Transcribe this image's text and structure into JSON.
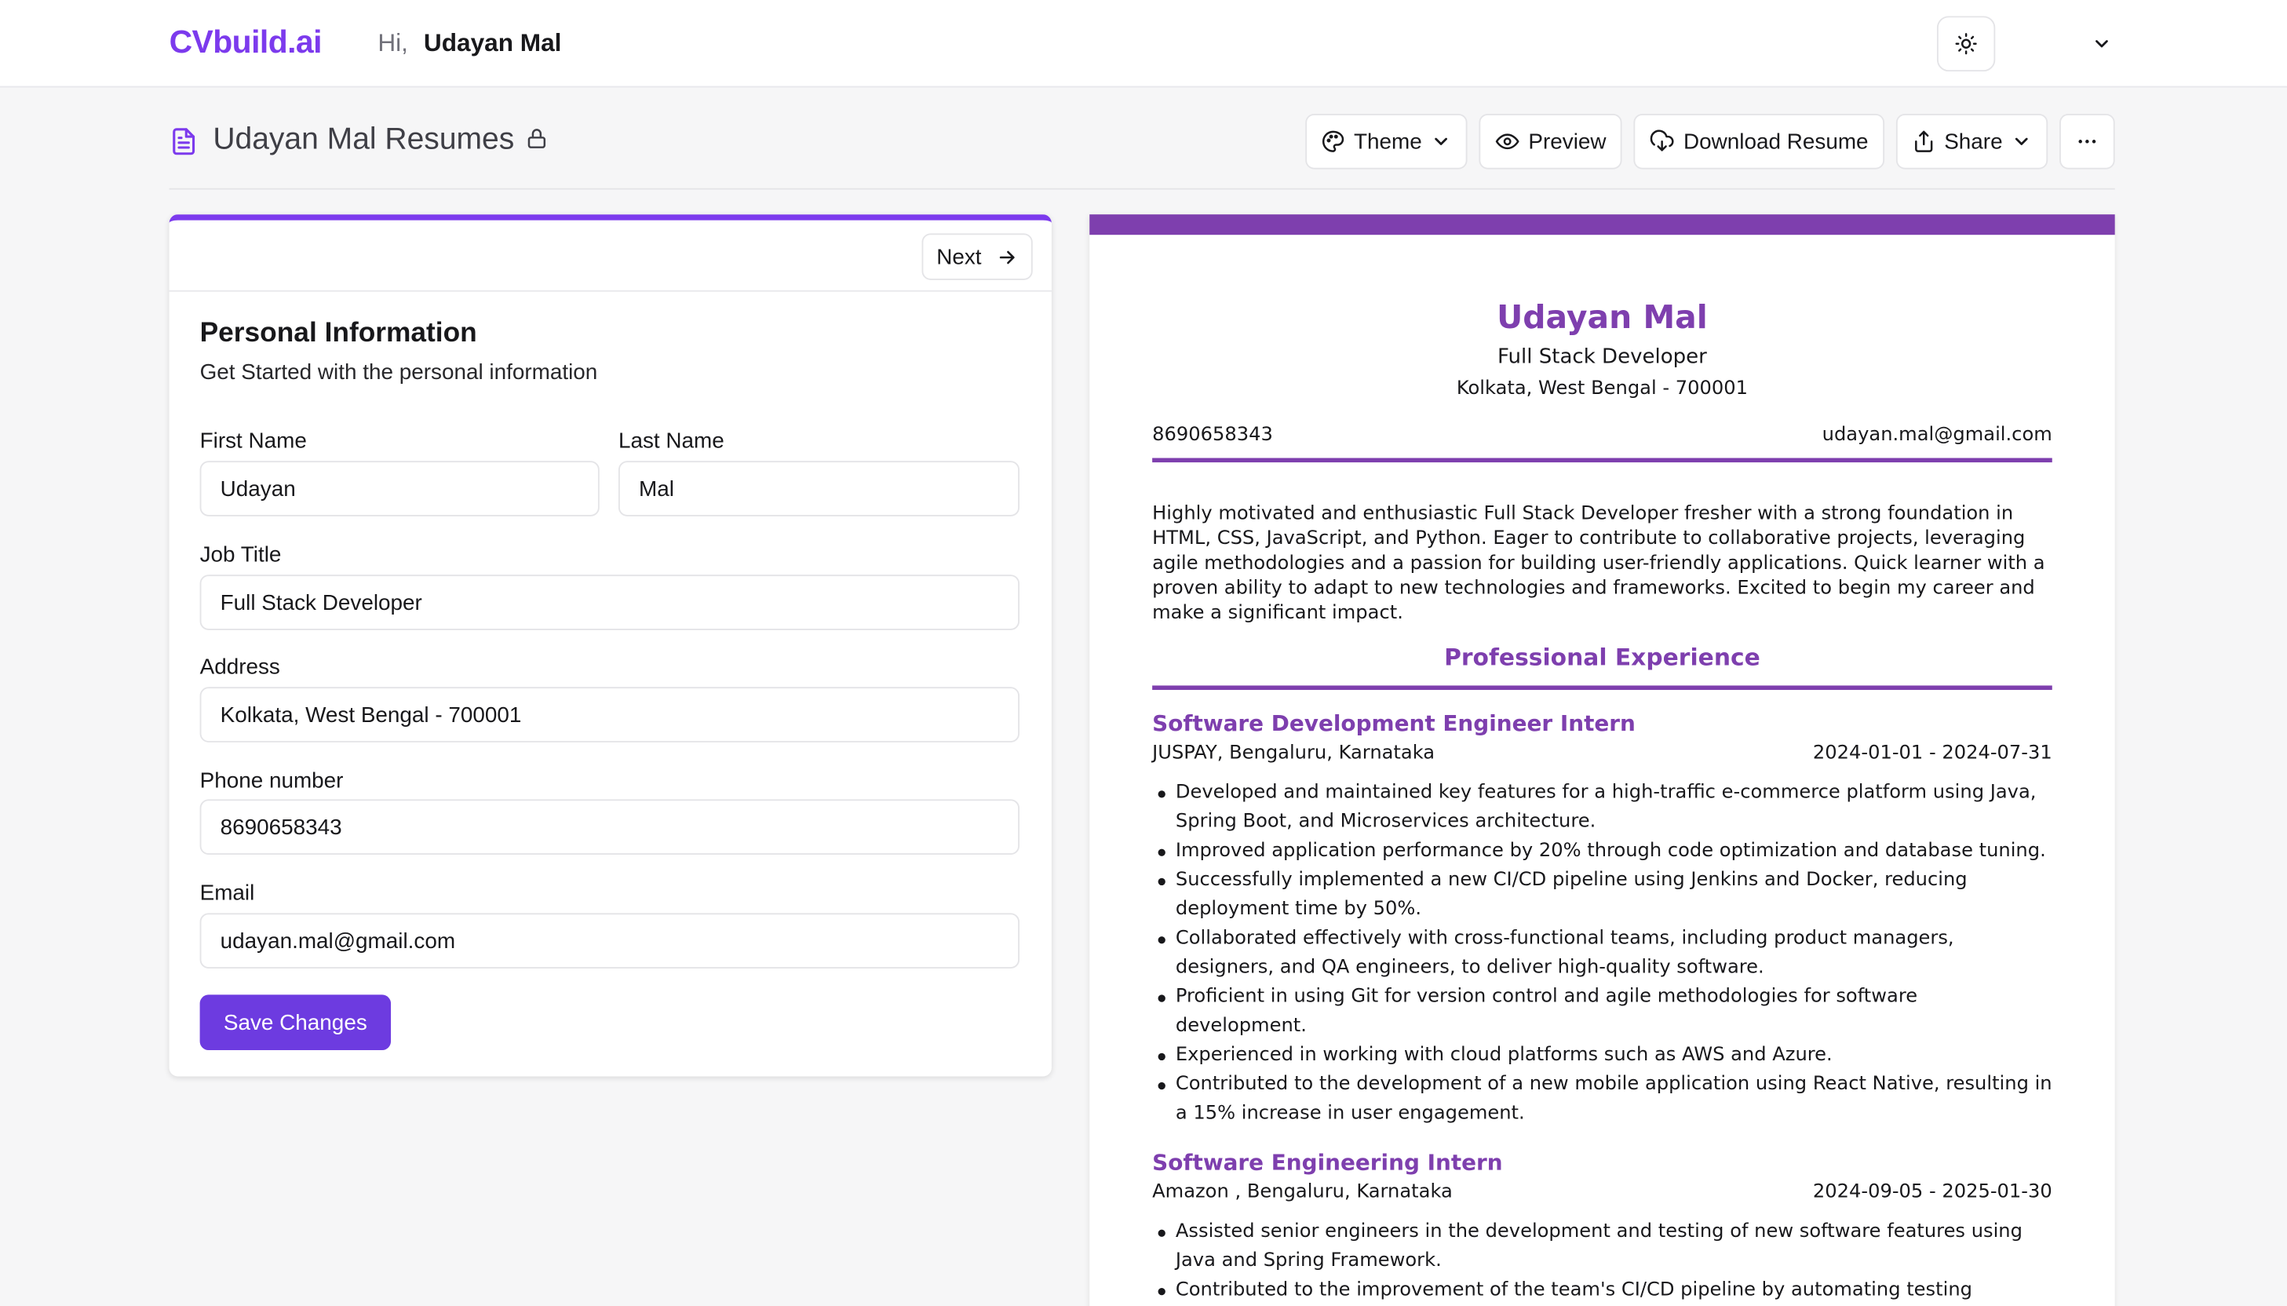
{
  "header": {
    "logo": "CVbuild.ai",
    "greeting_prefix": "Hi,",
    "user_name": "Udayan Mal"
  },
  "resume_header": {
    "title": "Udayan Mal Resumes",
    "actions": {
      "theme": "Theme",
      "preview": "Preview",
      "download": "Download Resume",
      "share": "Share"
    }
  },
  "form": {
    "next_label": "Next",
    "section_title": "Personal Information",
    "section_subtitle": "Get Started with the personal information",
    "fields": {
      "first_name": {
        "label": "First Name",
        "value": "Udayan"
      },
      "last_name": {
        "label": "Last Name",
        "value": "Mal"
      },
      "job_title": {
        "label": "Job Title",
        "value": "Full Stack Developer"
      },
      "address": {
        "label": "Address",
        "value": "Kolkata, West Bengal - 700001"
      },
      "phone": {
        "label": "Phone number",
        "value": "8690658343"
      },
      "email": {
        "label": "Email",
        "value": "udayan.mal@gmail.com"
      }
    },
    "save_label": "Save Changes"
  },
  "preview": {
    "accent_color": "#7e3fae",
    "name": "Udayan Mal",
    "job_title": "Full Stack Developer",
    "address": "Kolkata, West Bengal - 700001",
    "phone": "8690658343",
    "email": "udayan.mal@gmail.com",
    "summary": "Highly motivated and enthusiastic Full Stack Developer fresher with a strong foundation in HTML, CSS, JavaScript, and Python. Eager to contribute to collaborative projects, leveraging agile methodologies and a passion for building user-friendly applications. Quick learner with a proven ability to adapt to new technologies and frameworks. Excited to begin my career and make a significant impact.",
    "experience_heading": "Professional Experience",
    "experience": [
      {
        "title": "Software Development Engineer Intern",
        "company": "JUSPAY, Bengaluru, Karnataka",
        "dates": "2024-01-01 - 2024-07-31",
        "bullets": [
          "Developed and maintained key features for a high-traffic e-commerce platform using Java, Spring Boot, and Microservices architecture.",
          "Improved application performance by 20% through code optimization and database tuning.",
          "Successfully implemented a new CI/CD pipeline using Jenkins and Docker, reducing deployment time by 50%.",
          "Collaborated effectively with cross-functional teams, including product managers, designers, and QA engineers, to deliver high-quality software.",
          "Proficient in using Git for version control and agile methodologies for software development.",
          "Experienced in working with cloud platforms such as AWS and Azure.",
          "Contributed to the development of a new mobile application using React Native, resulting in a 15% increase in user engagement."
        ]
      },
      {
        "title": "Software Engineering Intern",
        "company": "Amazon , Bengaluru, Karnataka",
        "dates": "2024-09-05 - 2025-01-30",
        "bullets": [
          "Assisted senior engineers in the development and testing of new software features using Java and Spring Framework.",
          "Contributed to the improvement of the team's CI/CD pipeline by automating testing"
        ]
      }
    ]
  }
}
